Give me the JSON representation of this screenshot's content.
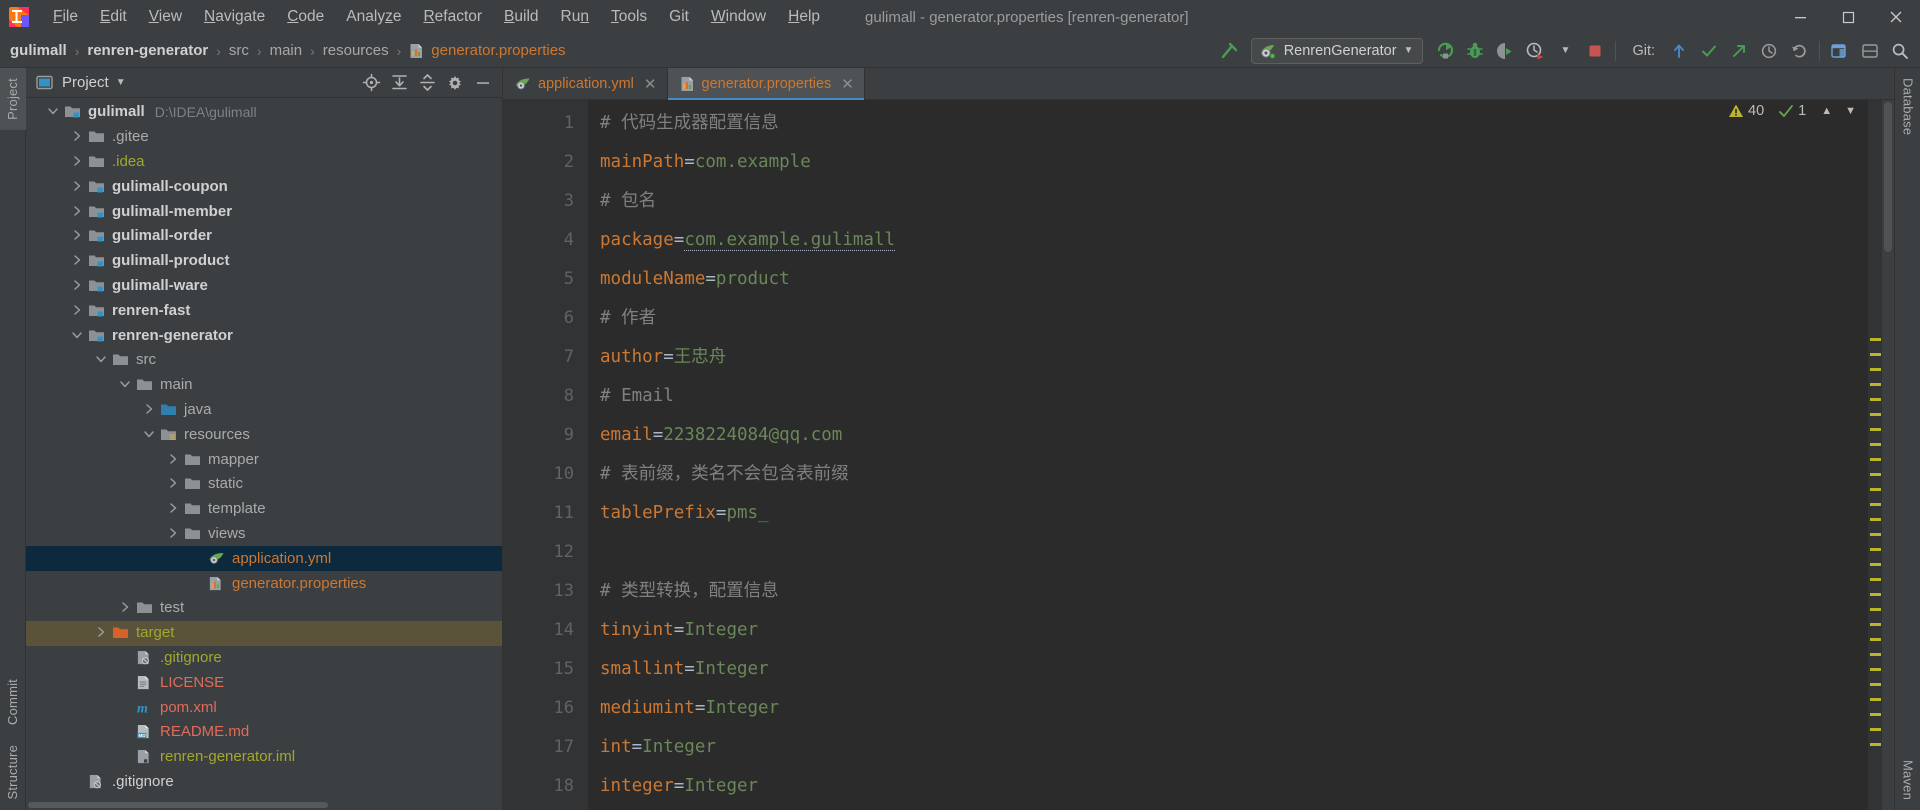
{
  "window": {
    "title": "gulimall - generator.properties [renren-generator]",
    "minimize_label": "—",
    "maximize_label": "❐",
    "close_label": "✕"
  },
  "menubar": {
    "items": [
      {
        "label": "File",
        "mnemonic": "F"
      },
      {
        "label": "Edit",
        "mnemonic": "E"
      },
      {
        "label": "View",
        "mnemonic": "V"
      },
      {
        "label": "Navigate",
        "mnemonic": "N"
      },
      {
        "label": "Code",
        "mnemonic": "C"
      },
      {
        "label": "Analyze",
        "mnemonic": "z"
      },
      {
        "label": "Refactor",
        "mnemonic": "R"
      },
      {
        "label": "Build",
        "mnemonic": "B"
      },
      {
        "label": "Run",
        "mnemonic": "n"
      },
      {
        "label": "Tools",
        "mnemonic": "T"
      },
      {
        "label": "Git",
        "mnemonic": ""
      },
      {
        "label": "Window",
        "mnemonic": "W"
      },
      {
        "label": "Help",
        "mnemonic": "H"
      }
    ]
  },
  "breadcrumb": {
    "separator": "›",
    "items": [
      {
        "label": "gulimall",
        "style": "bold"
      },
      {
        "label": "renren-generator",
        "style": "bold"
      },
      {
        "label": "src",
        "style": "dim"
      },
      {
        "label": "main",
        "style": "dim"
      },
      {
        "label": "resources",
        "style": "dim"
      },
      {
        "label": "generator.properties",
        "style": "file"
      }
    ]
  },
  "toolbar": {
    "run_config": "RenrenGenerator",
    "run_config_dropdown": "▼",
    "git_label": "Git:",
    "icons": [
      "build-hammer-icon",
      "run-icon",
      "debug-icon",
      "run-with-coverage-icon",
      "profile-icon",
      "more-dropdown-icon",
      "stop-icon",
      "git-update-icon",
      "git-commit-icon",
      "git-push-icon",
      "git-history-icon",
      "git-rollback-icon",
      "search-everywhere-icon",
      "settings-icon",
      "search-icon"
    ]
  },
  "stripes": {
    "left_top": [
      "Project"
    ],
    "left_bottom": [
      "Commit",
      "Structure"
    ],
    "right_top": [
      "Database"
    ],
    "right_bottom": [
      "Maven"
    ]
  },
  "project_panel": {
    "title": "Project",
    "title_dropdown": "▼",
    "actions": [
      "locate-target-icon",
      "expand-all-icon",
      "collapse-all-icon",
      "settings-gear-icon",
      "hide-panel-icon"
    ],
    "tree": [
      {
        "label": "gulimall",
        "path": "D:\\IDEA\\gulimall",
        "indent": 0,
        "twisty": "down",
        "icon": "module-folder",
        "style": "bold",
        "color": "#cfd0d1"
      },
      {
        "label": ".gitee",
        "indent": 1,
        "twisty": "right",
        "icon": "folder",
        "color": "#a9abac"
      },
      {
        "label": ".idea",
        "indent": 1,
        "twisty": "right",
        "icon": "folder",
        "color": "#a1a82d"
      },
      {
        "label": "gulimall-coupon",
        "indent": 1,
        "twisty": "right",
        "icon": "module-folder",
        "style": "bold",
        "color": "#cfd0d1"
      },
      {
        "label": "gulimall-member",
        "indent": 1,
        "twisty": "right",
        "icon": "module-folder",
        "style": "bold",
        "color": "#cfd0d1"
      },
      {
        "label": "gulimall-order",
        "indent": 1,
        "twisty": "right",
        "icon": "module-folder",
        "style": "bold",
        "color": "#cfd0d1"
      },
      {
        "label": "gulimall-product",
        "indent": 1,
        "twisty": "right",
        "icon": "module-folder",
        "style": "bold",
        "color": "#cfd0d1"
      },
      {
        "label": "gulimall-ware",
        "indent": 1,
        "twisty": "right",
        "icon": "module-folder",
        "style": "bold",
        "color": "#cfd0d1"
      },
      {
        "label": "renren-fast",
        "indent": 1,
        "twisty": "right",
        "icon": "module-folder",
        "style": "bold",
        "color": "#cfd0d1"
      },
      {
        "label": "renren-generator",
        "indent": 1,
        "twisty": "down",
        "icon": "module-folder",
        "style": "bold",
        "color": "#cfd0d1"
      },
      {
        "label": "src",
        "indent": 2,
        "twisty": "down",
        "icon": "folder",
        "color": "#a9abac"
      },
      {
        "label": "main",
        "indent": 3,
        "twisty": "down",
        "icon": "folder",
        "color": "#a9abac"
      },
      {
        "label": "java",
        "indent": 4,
        "twisty": "right",
        "icon": "source-folder",
        "color": "#a9abac"
      },
      {
        "label": "resources",
        "indent": 4,
        "twisty": "down",
        "icon": "resource-folder",
        "color": "#a9abac"
      },
      {
        "label": "mapper",
        "indent": 5,
        "twisty": "right",
        "icon": "folder",
        "color": "#a9abac"
      },
      {
        "label": "static",
        "indent": 5,
        "twisty": "right",
        "icon": "folder",
        "color": "#a9abac"
      },
      {
        "label": "template",
        "indent": 5,
        "twisty": "right",
        "icon": "folder",
        "color": "#a9abac"
      },
      {
        "label": "views",
        "indent": 5,
        "twisty": "right",
        "icon": "folder",
        "color": "#a9abac"
      },
      {
        "label": "application.yml",
        "indent": 6,
        "twisty": "none",
        "icon": "spring-yaml-file",
        "color": "#cc7832",
        "selected": true
      },
      {
        "label": "generator.properties",
        "indent": 6,
        "twisty": "none",
        "icon": "properties-file",
        "color": "#cc7832"
      },
      {
        "label": "test",
        "indent": 3,
        "twisty": "right",
        "icon": "folder",
        "color": "#a9abac"
      },
      {
        "label": "target",
        "indent": 2,
        "twisty": "right",
        "icon": "excluded-folder",
        "color": "#a1a82d",
        "highlighted": true
      },
      {
        "label": ".gitignore",
        "indent": 3,
        "twisty": "none",
        "icon": "gitignore-file",
        "color": "#a1a82d"
      },
      {
        "label": "LICENSE",
        "indent": 3,
        "twisty": "none",
        "icon": "text-file",
        "color": "#e06c5a"
      },
      {
        "label": "pom.xml",
        "indent": 3,
        "twisty": "none",
        "icon": "maven-file",
        "color": "#e06c5a"
      },
      {
        "label": "README.md",
        "indent": 3,
        "twisty": "none",
        "icon": "markdown-file",
        "color": "#e06c5a"
      },
      {
        "label": "renren-generator.iml",
        "indent": 3,
        "twisty": "none",
        "icon": "iml-file",
        "color": "#a1a82d"
      },
      {
        "label": ".gitignore",
        "indent": 1,
        "twisty": "none",
        "icon": "gitignore-file",
        "color": "#cfd0d1"
      }
    ]
  },
  "editor": {
    "tabs": [
      {
        "label": "application.yml",
        "icon": "spring-yaml-file",
        "active": false,
        "close": "✕"
      },
      {
        "label": "generator.properties",
        "icon": "properties-file",
        "active": true,
        "close": "✕"
      }
    ],
    "inspection": {
      "warning_icon": "warning-triangle-icon",
      "warning_count": "40",
      "typo_icon": "typo-check-icon",
      "typo_count": "1",
      "prev_icon": "chevron-up-icon",
      "next_icon": "chevron-down-icon"
    },
    "line_numbers": [
      "1",
      "2",
      "3",
      "4",
      "5",
      "6",
      "7",
      "8",
      "9",
      "10",
      "11",
      "12",
      "13",
      "14",
      "15",
      "16",
      "17",
      "18"
    ],
    "lines": [
      {
        "n": "1",
        "type": "comment",
        "text": "# 代码生成器配置信息"
      },
      {
        "n": "2",
        "type": "kv",
        "key": "mainPath",
        "value": "com.example"
      },
      {
        "n": "3",
        "type": "comment",
        "text": "# 包名"
      },
      {
        "n": "4",
        "type": "kv",
        "key": "package",
        "value": "com.example.gulimall",
        "warn": true
      },
      {
        "n": "5",
        "type": "kv",
        "key": "moduleName",
        "value": "product"
      },
      {
        "n": "6",
        "type": "comment",
        "text": "# 作者"
      },
      {
        "n": "7",
        "type": "kv",
        "key": "author",
        "value": "王忠舟"
      },
      {
        "n": "8",
        "type": "comment",
        "text": "# Email"
      },
      {
        "n": "9",
        "type": "kv",
        "key": "email",
        "value": "2238224084@qq.com"
      },
      {
        "n": "10",
        "type": "comment",
        "text": "# 表前缀，类名不会包含表前缀"
      },
      {
        "n": "11",
        "type": "kv",
        "key": "tablePrefix",
        "value": "pms_"
      },
      {
        "n": "12",
        "type": "blank",
        "text": ""
      },
      {
        "n": "13",
        "type": "comment",
        "text": "# 类型转换，配置信息"
      },
      {
        "n": "14",
        "type": "kv",
        "key": "tinyint",
        "value": "Integer"
      },
      {
        "n": "15",
        "type": "kv",
        "key": "smallint",
        "value": "Integer"
      },
      {
        "n": "16",
        "type": "kv",
        "key": "mediumint",
        "value": "Integer"
      },
      {
        "n": "17",
        "type": "kv",
        "key": "int",
        "value": "Integer"
      },
      {
        "n": "18",
        "type": "kv",
        "key": "integer",
        "value": "Integer"
      }
    ],
    "markers_count": 14
  },
  "colors": {
    "bg_panel": "#3c3f41",
    "bg_editor": "#2b2b2b",
    "bg_gutter": "#313335",
    "accent_blue": "#4a88c7",
    "selection": "#0d293e",
    "highlight_olive": "#5b5339",
    "key_orange": "#cc7832",
    "value_green": "#6a8759",
    "comment_gray": "#808080",
    "warning_yellow": "#bbb529",
    "run_green": "#499c54"
  }
}
